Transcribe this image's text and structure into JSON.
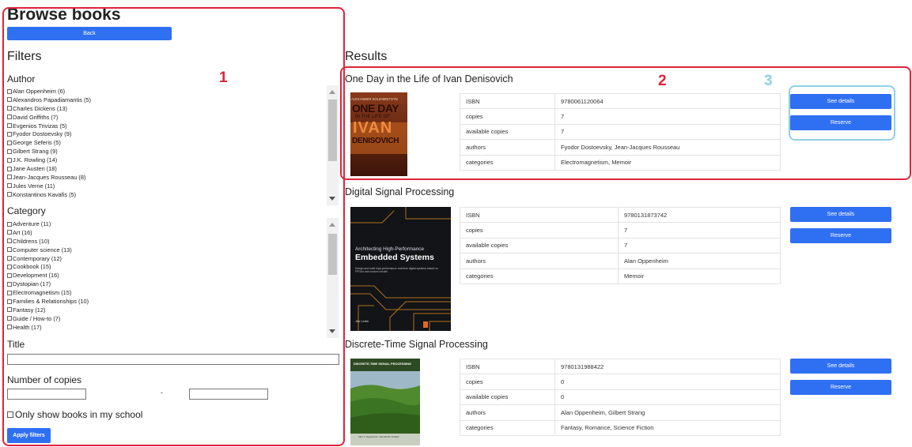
{
  "page": {
    "title": "Browse books",
    "back_label": "Back",
    "filters_title": "Filters",
    "results_title": "Results"
  },
  "filters": {
    "author": {
      "title": "Author",
      "items": [
        "Alan Oppenheim (6)",
        "Alexandros Papadiamantis (5)",
        "Charles Dickens (13)",
        "David Griffiths (7)",
        "Evgenios Trivizas (5)",
        "Fyodor Dostoevsky (9)",
        "George Seferis (5)",
        "Gilbert Strang (9)",
        "J.K. Rowling (14)",
        "Jane Austen (18)",
        "Jean-Jacques Rousseau (8)",
        "Jules Verne (11)",
        "Konstantinos Kavafis (5)"
      ]
    },
    "category": {
      "title": "Category",
      "items": [
        "Adventure (11)",
        "Art (16)",
        "Childrens (10)",
        "Computer science (13)",
        "Contemporary (12)",
        "Cookbook (15)",
        "Development (16)",
        "Dystopian (17)",
        "Electromagnetism (15)",
        "Families & Relationships (10)",
        "Fantasy (12)",
        "Guide / How-to (7)",
        "Health (17)"
      ]
    },
    "title_label": "Title",
    "title_value": "",
    "copies_label": "Number of copies",
    "copies_min": "",
    "copies_separator": "-",
    "copies_max": "",
    "school_label": "Only show books in my school",
    "apply_label": "Apply filters"
  },
  "results": [
    {
      "title": "One Day in the Life of Ivan Denisovich",
      "fields": [
        {
          "key": "ISBN",
          "value": "9780061120064"
        },
        {
          "key": "copies",
          "value": "7"
        },
        {
          "key": "available copies",
          "value": "7"
        },
        {
          "key": "authors",
          "value": "Fyodor Dostoevsky, Jean-Jacques Rousseau"
        },
        {
          "key": "categories",
          "value": "Electromagnetism, Memoir"
        }
      ],
      "cover": {
        "top_text": "ALEXANDER SOLZHENITSYN",
        "title_1": "ONE DAY",
        "title_2": "IN THE LIFE OF",
        "title_3": "IVAN",
        "title_4": "DENISOVICH"
      },
      "details_label": "See details",
      "reserve_label": "Reserve"
    },
    {
      "title": "Digital Signal Processing",
      "fields": [
        {
          "key": "ISBN",
          "value": "9780131873742"
        },
        {
          "key": "copies",
          "value": "7"
        },
        {
          "key": "available copies",
          "value": "7"
        },
        {
          "key": "authors",
          "value": "Alan Oppenheim"
        },
        {
          "key": "categories",
          "value": "Memoir"
        }
      ],
      "cover": {
        "title_1": "Architecting High-Performance",
        "title_2": "Embedded Systems",
        "subtitle": "Design and build high-performance real-time digital systems based on FPGAs and custom circuits",
        "author": "Jim Ledin"
      },
      "details_label": "See details",
      "reserve_label": "Reserve"
    },
    {
      "title": "Discrete-Time Signal Processing",
      "fields": [
        {
          "key": "ISBN",
          "value": "9780131988422"
        },
        {
          "key": "copies",
          "value": "0"
        },
        {
          "key": "available copies",
          "value": "0"
        },
        {
          "key": "authors",
          "value": "Alan Oppenheim, Gilbert Strang"
        },
        {
          "key": "categories",
          "value": "Fantasy, Romance, Science Fiction"
        }
      ],
      "cover": {
        "title_1": "DISCRETE-TIME SIGNAL PROCESSING",
        "author": "Alan V. Oppenheim • Ronald W. Schafer"
      },
      "details_label": "See details",
      "reserve_label": "Reserve"
    }
  ],
  "annotations": {
    "n1": "1",
    "n2": "2",
    "n3": "3",
    "red": "#e0243a",
    "blue": "#8fd0e6"
  },
  "colors": {
    "primary_button": "#2f6ff2"
  }
}
